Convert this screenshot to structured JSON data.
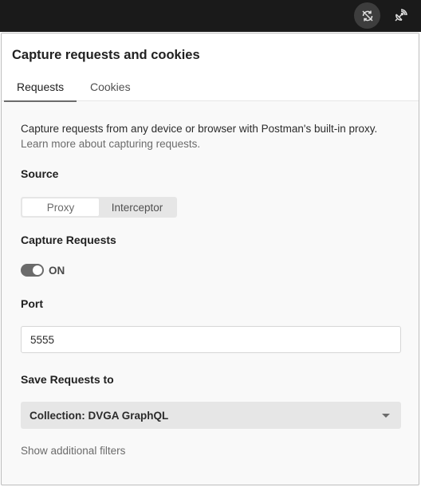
{
  "topbar": {
    "sync_icon": "sync-off-icon",
    "capture_icon": "satellite-dish-icon"
  },
  "panel": {
    "title": "Capture requests and cookies",
    "tabs": [
      {
        "label": "Requests",
        "active": true
      },
      {
        "label": "Cookies",
        "active": false
      }
    ],
    "description": "Capture requests from any device or browser with Postman's built-in proxy.",
    "learn_more": "Learn more about capturing requests.",
    "source": {
      "label": "Source",
      "options": [
        "Proxy",
        "Interceptor"
      ],
      "selected": "Proxy"
    },
    "capture_requests": {
      "label": "Capture Requests",
      "state": "ON"
    },
    "port": {
      "label": "Port",
      "value": "5555"
    },
    "save_requests": {
      "label": "Save Requests to",
      "value": "Collection: DVGA GraphQL"
    },
    "filters_link": "Show additional filters"
  },
  "colors": {
    "topbar_bg": "#1a1a1a",
    "panel_bg": "#f9f9f9",
    "toggle_on": "#6b6b6b"
  }
}
